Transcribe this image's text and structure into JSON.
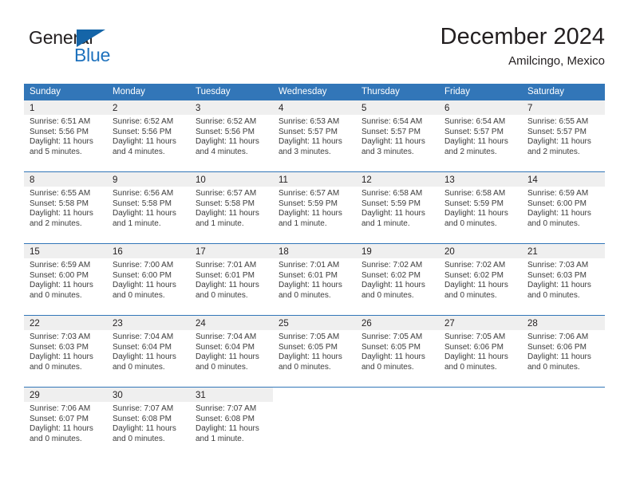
{
  "brand": {
    "name_part1": "General",
    "name_part2": "Blue"
  },
  "header": {
    "title": "December 2024",
    "subtitle": "Amilcingo, Mexico"
  },
  "colors": {
    "header_blue": "#3276b8",
    "brand_blue": "#1f72bd",
    "daynum_band": "#efefef",
    "text": "#231f20"
  },
  "weekdays": [
    "Sunday",
    "Monday",
    "Tuesday",
    "Wednesday",
    "Thursday",
    "Friday",
    "Saturday"
  ],
  "weeks": [
    [
      {
        "day": "1",
        "sunrise": "Sunrise: 6:51 AM",
        "sunset": "Sunset: 5:56 PM",
        "daylight1": "Daylight: 11 hours",
        "daylight2": "and 5 minutes."
      },
      {
        "day": "2",
        "sunrise": "Sunrise: 6:52 AM",
        "sunset": "Sunset: 5:56 PM",
        "daylight1": "Daylight: 11 hours",
        "daylight2": "and 4 minutes."
      },
      {
        "day": "3",
        "sunrise": "Sunrise: 6:52 AM",
        "sunset": "Sunset: 5:56 PM",
        "daylight1": "Daylight: 11 hours",
        "daylight2": "and 4 minutes."
      },
      {
        "day": "4",
        "sunrise": "Sunrise: 6:53 AM",
        "sunset": "Sunset: 5:57 PM",
        "daylight1": "Daylight: 11 hours",
        "daylight2": "and 3 minutes."
      },
      {
        "day": "5",
        "sunrise": "Sunrise: 6:54 AM",
        "sunset": "Sunset: 5:57 PM",
        "daylight1": "Daylight: 11 hours",
        "daylight2": "and 3 minutes."
      },
      {
        "day": "6",
        "sunrise": "Sunrise: 6:54 AM",
        "sunset": "Sunset: 5:57 PM",
        "daylight1": "Daylight: 11 hours",
        "daylight2": "and 2 minutes."
      },
      {
        "day": "7",
        "sunrise": "Sunrise: 6:55 AM",
        "sunset": "Sunset: 5:57 PM",
        "daylight1": "Daylight: 11 hours",
        "daylight2": "and 2 minutes."
      }
    ],
    [
      {
        "day": "8",
        "sunrise": "Sunrise: 6:55 AM",
        "sunset": "Sunset: 5:58 PM",
        "daylight1": "Daylight: 11 hours",
        "daylight2": "and 2 minutes."
      },
      {
        "day": "9",
        "sunrise": "Sunrise: 6:56 AM",
        "sunset": "Sunset: 5:58 PM",
        "daylight1": "Daylight: 11 hours",
        "daylight2": "and 1 minute."
      },
      {
        "day": "10",
        "sunrise": "Sunrise: 6:57 AM",
        "sunset": "Sunset: 5:58 PM",
        "daylight1": "Daylight: 11 hours",
        "daylight2": "and 1 minute."
      },
      {
        "day": "11",
        "sunrise": "Sunrise: 6:57 AM",
        "sunset": "Sunset: 5:59 PM",
        "daylight1": "Daylight: 11 hours",
        "daylight2": "and 1 minute."
      },
      {
        "day": "12",
        "sunrise": "Sunrise: 6:58 AM",
        "sunset": "Sunset: 5:59 PM",
        "daylight1": "Daylight: 11 hours",
        "daylight2": "and 1 minute."
      },
      {
        "day": "13",
        "sunrise": "Sunrise: 6:58 AM",
        "sunset": "Sunset: 5:59 PM",
        "daylight1": "Daylight: 11 hours",
        "daylight2": "and 0 minutes."
      },
      {
        "day": "14",
        "sunrise": "Sunrise: 6:59 AM",
        "sunset": "Sunset: 6:00 PM",
        "daylight1": "Daylight: 11 hours",
        "daylight2": "and 0 minutes."
      }
    ],
    [
      {
        "day": "15",
        "sunrise": "Sunrise: 6:59 AM",
        "sunset": "Sunset: 6:00 PM",
        "daylight1": "Daylight: 11 hours",
        "daylight2": "and 0 minutes."
      },
      {
        "day": "16",
        "sunrise": "Sunrise: 7:00 AM",
        "sunset": "Sunset: 6:00 PM",
        "daylight1": "Daylight: 11 hours",
        "daylight2": "and 0 minutes."
      },
      {
        "day": "17",
        "sunrise": "Sunrise: 7:01 AM",
        "sunset": "Sunset: 6:01 PM",
        "daylight1": "Daylight: 11 hours",
        "daylight2": "and 0 minutes."
      },
      {
        "day": "18",
        "sunrise": "Sunrise: 7:01 AM",
        "sunset": "Sunset: 6:01 PM",
        "daylight1": "Daylight: 11 hours",
        "daylight2": "and 0 minutes."
      },
      {
        "day": "19",
        "sunrise": "Sunrise: 7:02 AM",
        "sunset": "Sunset: 6:02 PM",
        "daylight1": "Daylight: 11 hours",
        "daylight2": "and 0 minutes."
      },
      {
        "day": "20",
        "sunrise": "Sunrise: 7:02 AM",
        "sunset": "Sunset: 6:02 PM",
        "daylight1": "Daylight: 11 hours",
        "daylight2": "and 0 minutes."
      },
      {
        "day": "21",
        "sunrise": "Sunrise: 7:03 AM",
        "sunset": "Sunset: 6:03 PM",
        "daylight1": "Daylight: 11 hours",
        "daylight2": "and 0 minutes."
      }
    ],
    [
      {
        "day": "22",
        "sunrise": "Sunrise: 7:03 AM",
        "sunset": "Sunset: 6:03 PM",
        "daylight1": "Daylight: 11 hours",
        "daylight2": "and 0 minutes."
      },
      {
        "day": "23",
        "sunrise": "Sunrise: 7:04 AM",
        "sunset": "Sunset: 6:04 PM",
        "daylight1": "Daylight: 11 hours",
        "daylight2": "and 0 minutes."
      },
      {
        "day": "24",
        "sunrise": "Sunrise: 7:04 AM",
        "sunset": "Sunset: 6:04 PM",
        "daylight1": "Daylight: 11 hours",
        "daylight2": "and 0 minutes."
      },
      {
        "day": "25",
        "sunrise": "Sunrise: 7:05 AM",
        "sunset": "Sunset: 6:05 PM",
        "daylight1": "Daylight: 11 hours",
        "daylight2": "and 0 minutes."
      },
      {
        "day": "26",
        "sunrise": "Sunrise: 7:05 AM",
        "sunset": "Sunset: 6:05 PM",
        "daylight1": "Daylight: 11 hours",
        "daylight2": "and 0 minutes."
      },
      {
        "day": "27",
        "sunrise": "Sunrise: 7:05 AM",
        "sunset": "Sunset: 6:06 PM",
        "daylight1": "Daylight: 11 hours",
        "daylight2": "and 0 minutes."
      },
      {
        "day": "28",
        "sunrise": "Sunrise: 7:06 AM",
        "sunset": "Sunset: 6:06 PM",
        "daylight1": "Daylight: 11 hours",
        "daylight2": "and 0 minutes."
      }
    ],
    [
      {
        "day": "29",
        "sunrise": "Sunrise: 7:06 AM",
        "sunset": "Sunset: 6:07 PM",
        "daylight1": "Daylight: 11 hours",
        "daylight2": "and 0 minutes."
      },
      {
        "day": "30",
        "sunrise": "Sunrise: 7:07 AM",
        "sunset": "Sunset: 6:08 PM",
        "daylight1": "Daylight: 11 hours",
        "daylight2": "and 0 minutes."
      },
      {
        "day": "31",
        "sunrise": "Sunrise: 7:07 AM",
        "sunset": "Sunset: 6:08 PM",
        "daylight1": "Daylight: 11 hours",
        "daylight2": "and 1 minute."
      },
      {
        "day": "",
        "sunrise": "",
        "sunset": "",
        "daylight1": "",
        "daylight2": ""
      },
      {
        "day": "",
        "sunrise": "",
        "sunset": "",
        "daylight1": "",
        "daylight2": ""
      },
      {
        "day": "",
        "sunrise": "",
        "sunset": "",
        "daylight1": "",
        "daylight2": ""
      },
      {
        "day": "",
        "sunrise": "",
        "sunset": "",
        "daylight1": "",
        "daylight2": ""
      }
    ]
  ]
}
